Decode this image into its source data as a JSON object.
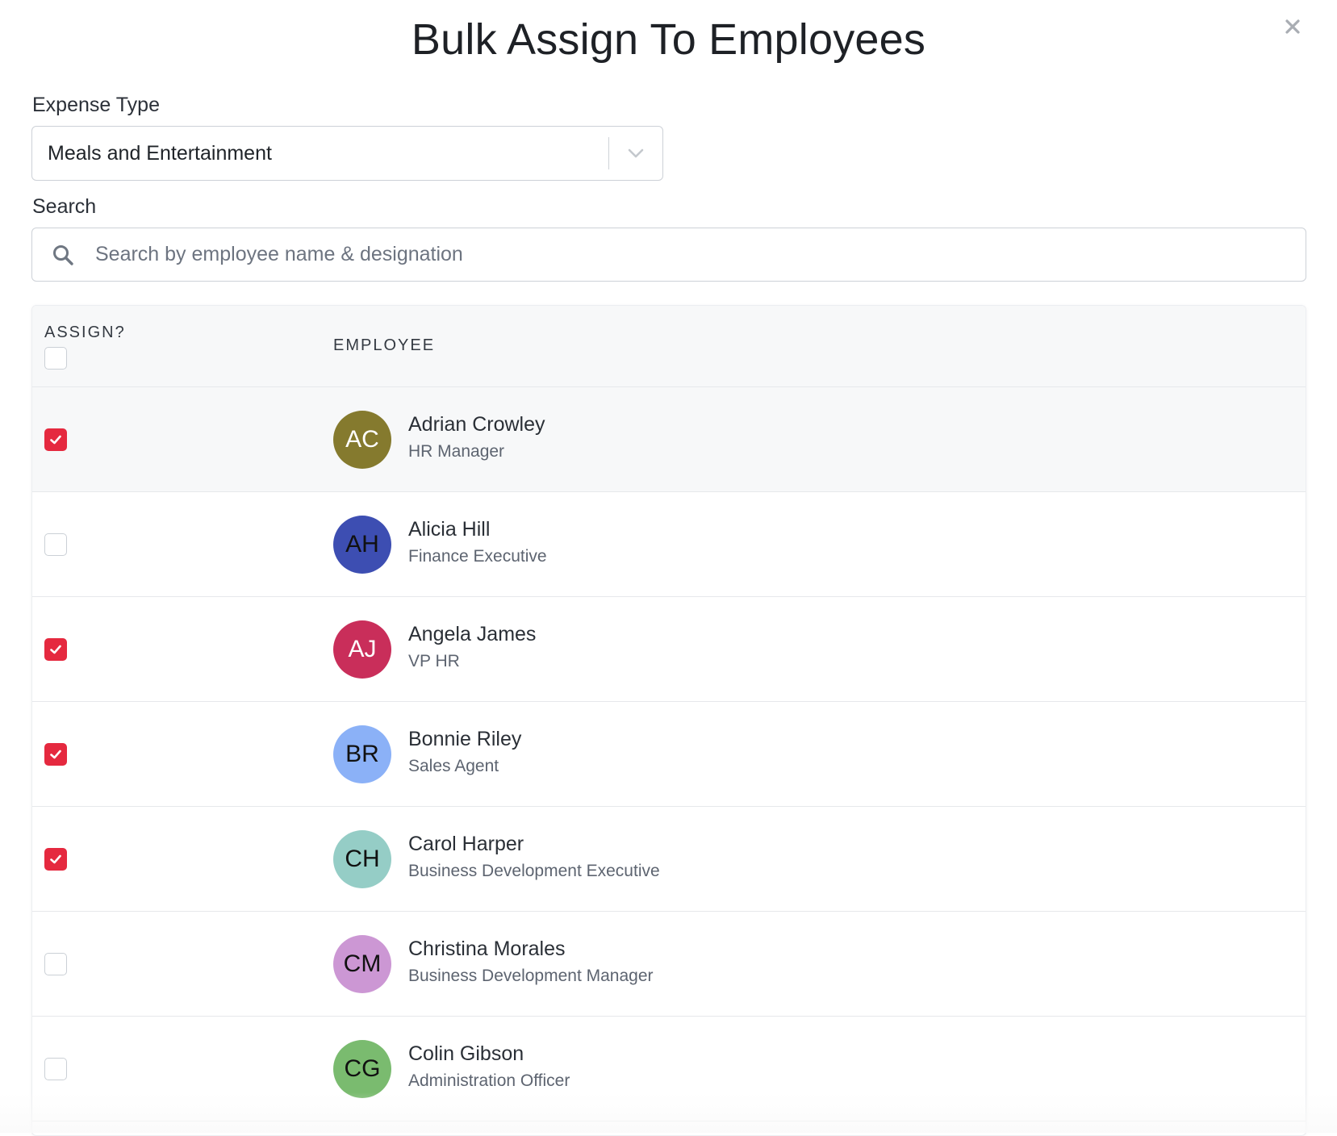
{
  "modal": {
    "title": "Bulk Assign To Employees",
    "close_label": "×"
  },
  "expense_type": {
    "label": "Expense Type",
    "selected": "Meals and Entertainment"
  },
  "search": {
    "label": "Search",
    "placeholder": "Search by employee name & designation",
    "value": ""
  },
  "table": {
    "col_assign": "ASSIGN?",
    "col_employee": "EMPLOYEE",
    "select_all_checked": false,
    "rows": [
      {
        "initials": "AC",
        "name": "Adrian Crowley",
        "role": "HR Manager",
        "checked": true,
        "avatar_color": "#857a2e",
        "avatar_text_color": "#ffffff"
      },
      {
        "initials": "AH",
        "name": "Alicia Hill",
        "role": "Finance Executive",
        "checked": false,
        "avatar_color": "#3d4eb2",
        "avatar_text_color": "#111111"
      },
      {
        "initials": "AJ",
        "name": "Angela James",
        "role": "VP HR",
        "checked": true,
        "avatar_color": "#c92e5a",
        "avatar_text_color": "#ffffff"
      },
      {
        "initials": "BR",
        "name": "Bonnie Riley",
        "role": "Sales Agent",
        "checked": true,
        "avatar_color": "#8bb1f7",
        "avatar_text_color": "#111111"
      },
      {
        "initials": "CH",
        "name": "Carol Harper",
        "role": "Business Development Executive",
        "checked": true,
        "avatar_color": "#95cdc6",
        "avatar_text_color": "#111111"
      },
      {
        "initials": "CM",
        "name": "Christina Morales",
        "role": "Business Development Manager",
        "checked": false,
        "avatar_color": "#cc97d4",
        "avatar_text_color": "#111111"
      },
      {
        "initials": "CG",
        "name": "Colin Gibson",
        "role": "Administration Officer",
        "checked": false,
        "avatar_color": "#7abb6f",
        "avatar_text_color": "#111111"
      }
    ]
  },
  "colors": {
    "checkbox_checked": "#e5293f",
    "row_highlight": "#f7f8f9"
  },
  "icons": {
    "close": "close-icon",
    "chevron": "chevron-down-icon",
    "search": "search-icon",
    "check": "check-icon"
  }
}
